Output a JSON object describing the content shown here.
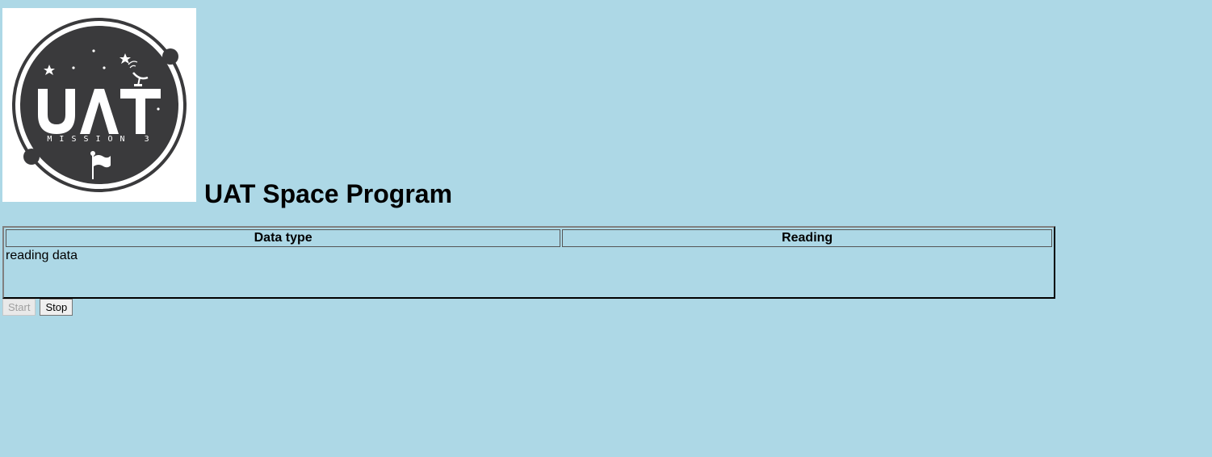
{
  "header": {
    "title": "UAT Space Program",
    "logo": {
      "main_text": "UAT",
      "sub_text": "MISSION 3"
    }
  },
  "table": {
    "columns": [
      "Data type",
      "Reading"
    ],
    "status_text": "reading data"
  },
  "buttons": {
    "start_label": "Start",
    "stop_label": "Stop"
  },
  "colors": {
    "page_background": "#add8e6",
    "logo_dark": "#3a3a3c"
  }
}
